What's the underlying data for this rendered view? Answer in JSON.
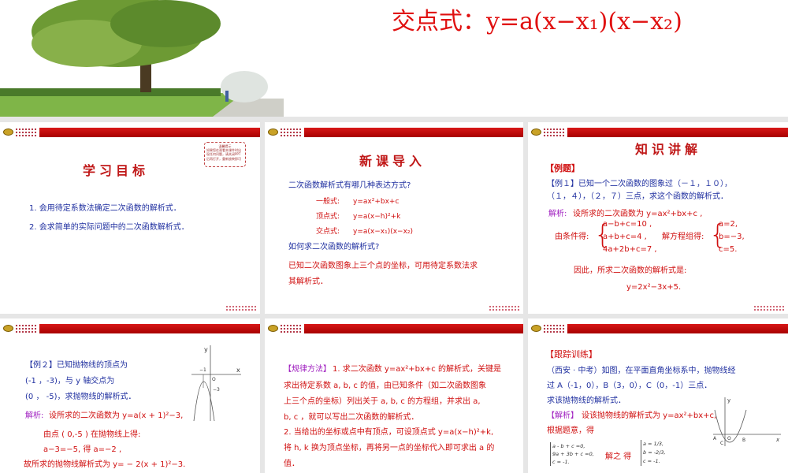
{
  "banner": {
    "formula": "交点式：y=a(x−x₁)(x−x₂)"
  },
  "slide1": {
    "title": "学习目标",
    "note_title": "温馨提示",
    "note_body": "如果您在观看本课件时出现任何问题，请关闭PPT后再打开，重新放映即可",
    "items": [
      "1. 会用待定系数法确定二次函数的解析式．",
      "2. 会求简单的实际问题中的二次函数解析式．"
    ]
  },
  "slide2": {
    "title": "新课导入",
    "q1": "二次函数解析式有哪几种表达方式?",
    "forms": [
      {
        "label": "一般式:",
        "expr": "y=ax²+bx+c"
      },
      {
        "label": "顶点式:",
        "expr": "y=a(x−h)²+k"
      },
      {
        "label": "交点式:",
        "expr": "y=a(x−x₁)(x−x₂)"
      }
    ],
    "q2": "如何求二次函数的解析式?",
    "answer": [
      "已知二次函数图象上三个点的坐标，可用待定系数法求",
      "其解析式．"
    ]
  },
  "slide3": {
    "title": "知识讲解",
    "tag": "【例题】",
    "example": [
      "【例１】已知一个二次函数的图象过（－１，１０），",
      "（１，４），（２，７）三点，求这个函数的解析式．"
    ],
    "analysis_label": "解析:",
    "analysis": "设所求的二次函数为 y=ax²+bx+c ,",
    "cond_label": "由条件得:",
    "cond": [
      "a−b+c=10 ,",
      "a+b+c=4 ,",
      "4a+2b+c=7 ,"
    ],
    "solve_label": "解方程组得:",
    "sol": [
      "a=2,",
      "b=−3,",
      "c=5."
    ],
    "conclusion": "因此，所求二次函数的解析式是:",
    "result": "y=2x²−3x+5."
  },
  "slide4": {
    "example": [
      "【例２】已知抛物线的顶点为",
      "(-1 ，-3)，与 y 轴交点为",
      "(0 ， -5)，求抛物线的解析式．"
    ],
    "analysis_label": "解析:",
    "lines": [
      "设所求的二次函数为 y=a(x + 1)²−3,",
      "由点 ( 0,-5 ) 在抛物线上得:",
      "a−3=−5,  得 a=−2 ,",
      "故所求的抛物线解析式为 y= − 2(x + 1)²−3."
    ],
    "graph": {
      "y": "y",
      "x": "x",
      "o": "O",
      "m1": "−1",
      "m3": "−3"
    }
  },
  "slide5": {
    "tag": "【规律方法】",
    "lines": [
      "1. 求二次函数 y=ax²+bx+c 的解析式，关键是",
      "求出待定系数 a, b, c 的值，由已知条件（如二次函数图象",
      "上三个点的坐标）列出关于 a, b, c 的方程组，并求出 a,",
      "b, c ，就可以写出二次函数的解析式．",
      "2. 当给出的坐标或点中有顶点，可设顶点式 y=a(x−h)²+k,",
      "将 h, k 换为顶点坐标，再将另一点的坐标代入即可求出 a 的",
      "值．"
    ]
  },
  "slide6": {
    "tag": "【跟踪训练】",
    "problem": [
      "（西安 · 中考）如图，在平面直角坐标系中，抛物线经",
      "过 A（-1，0），B（3，0），C（0，-1）三点．",
      "求该抛物线的解析式．"
    ],
    "analysis_tag": "【解析】",
    "analysis": "设该抛物线的解析式为 y=ax²+bx+c,",
    "according": "根据题意，得",
    "system": [
      "a - b + c =0,",
      "9a + 3b + c =0,",
      "c = -1."
    ],
    "solve": "解之 得",
    "sol": [
      "a = 1/3,",
      "b = -2/3,",
      "c = -1."
    ],
    "graph": {
      "y": "y",
      "x": "x",
      "a": "A",
      "o": "O",
      "b": "B",
      "c": "C"
    }
  }
}
